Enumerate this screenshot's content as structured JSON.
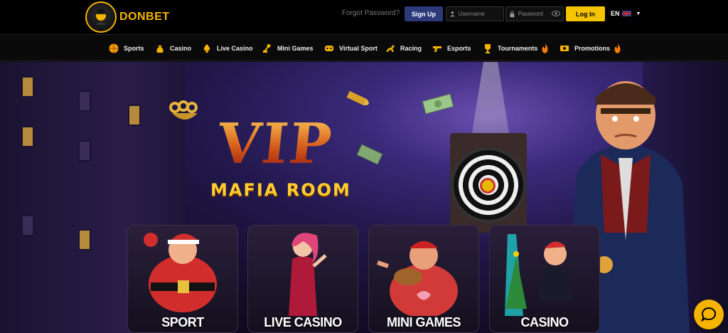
{
  "header": {
    "logo_text": "DONBET",
    "forgot_password": "Forgot Password?",
    "signup_label": "Sign Up",
    "username_placeholder": "Username",
    "password_placeholder": "Password",
    "login_label": "Log In",
    "language": "EN"
  },
  "nav": {
    "items": [
      {
        "label": "Sports",
        "icon": "basketball-icon"
      },
      {
        "label": "Casino",
        "icon": "money-bag-icon"
      },
      {
        "label": "Live Casino",
        "icon": "spade-icon"
      },
      {
        "label": "Mini Games",
        "icon": "joystick-icon"
      },
      {
        "label": "Virtual Sport",
        "icon": "gamepad-icon"
      },
      {
        "label": "Racing",
        "icon": "horse-icon"
      },
      {
        "label": "Esports",
        "icon": "gun-icon"
      },
      {
        "label": "Tournaments",
        "icon": "trophy-icon"
      },
      {
        "label": "Promotions",
        "icon": "ticket-icon"
      }
    ]
  },
  "hero": {
    "title": "VIP",
    "subtitle": "MAFIA ROOM"
  },
  "categories": [
    {
      "label": "SPORT"
    },
    {
      "label": "LIVE CASINO"
    },
    {
      "label": "MINI GAMES"
    },
    {
      "label": "CASINO"
    }
  ],
  "colors": {
    "accent": "#f5c400",
    "signup": "#2c3a7a",
    "background": "#000000"
  }
}
